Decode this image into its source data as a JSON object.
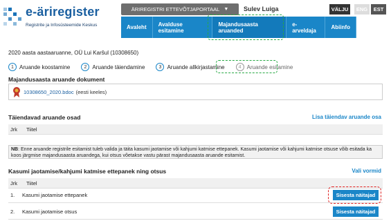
{
  "header": {
    "logo_title": "e-äriregister",
    "logo_subtitle": "Registrite ja Infosüsteemide Keskus",
    "portal_button": "ÄRIREGISTRI ETTEVÕTJAPORTAAL",
    "user_name": "Sulev Luiga",
    "logout": "VÄLJU",
    "lang_eng": "ENG",
    "lang_est": "EST"
  },
  "nav": {
    "items": [
      {
        "label": "Avaleht"
      },
      {
        "label": "Avalduse esitamine"
      },
      {
        "label": "Majandusaasta aruanded"
      },
      {
        "label": "e-arveldaja"
      },
      {
        "label": "Abiinfo"
      }
    ]
  },
  "report": {
    "subtitle": "2020 aasta aastaaruanne,   OÜ Lui Karšul (10308650)",
    "steps": [
      {
        "num": "1",
        "label": "Aruande koostamine"
      },
      {
        "num": "2",
        "label": "Aruande täiendamine"
      },
      {
        "num": "3",
        "label": "Aruande allkirjastamine"
      },
      {
        "num": "4",
        "label": "Aruande esitamine"
      }
    ],
    "doc_section_title": "Majandusaasta aruande dokument",
    "doc_link": "10308650_2020.bdoc",
    "doc_lang": "(eesti keeles)",
    "supplement_title": "Täiendavad aruande osad",
    "supplement_link": "Lisa täiendav aruande osa",
    "col_jrk": "Jrk",
    "col_tiitel": "Tiitel",
    "note_bold": "NB",
    "note_text": ": Enne aruande registrile esitamist tuleb valida ja täita kasumi jaotamise või kahjumi katmise ettepanek. Kasumi jaotamise või kahjumi katmise otsuse võib esitada ka koos järgmise majandusaasta aruandega, kui otsus võetakse vastu pärast majandusaasta aruande esitamist.",
    "profit_title": "Kasumi jaotamise/kahjumi katmise ettepanek ning otsus",
    "profit_link": "Vali vormid",
    "rows": [
      {
        "num": "1.",
        "label": "Kasumi jaotamise ettepanek",
        "button": "Sisesta näitajad"
      },
      {
        "num": "2.",
        "label": "Kasumi jaotamise otsus",
        "button": "Sisesta näitajad"
      }
    ]
  },
  "colors": {
    "nav_blue": "#1a86c8",
    "highlight_green": "#27a844",
    "highlight_red": "#e02020"
  }
}
